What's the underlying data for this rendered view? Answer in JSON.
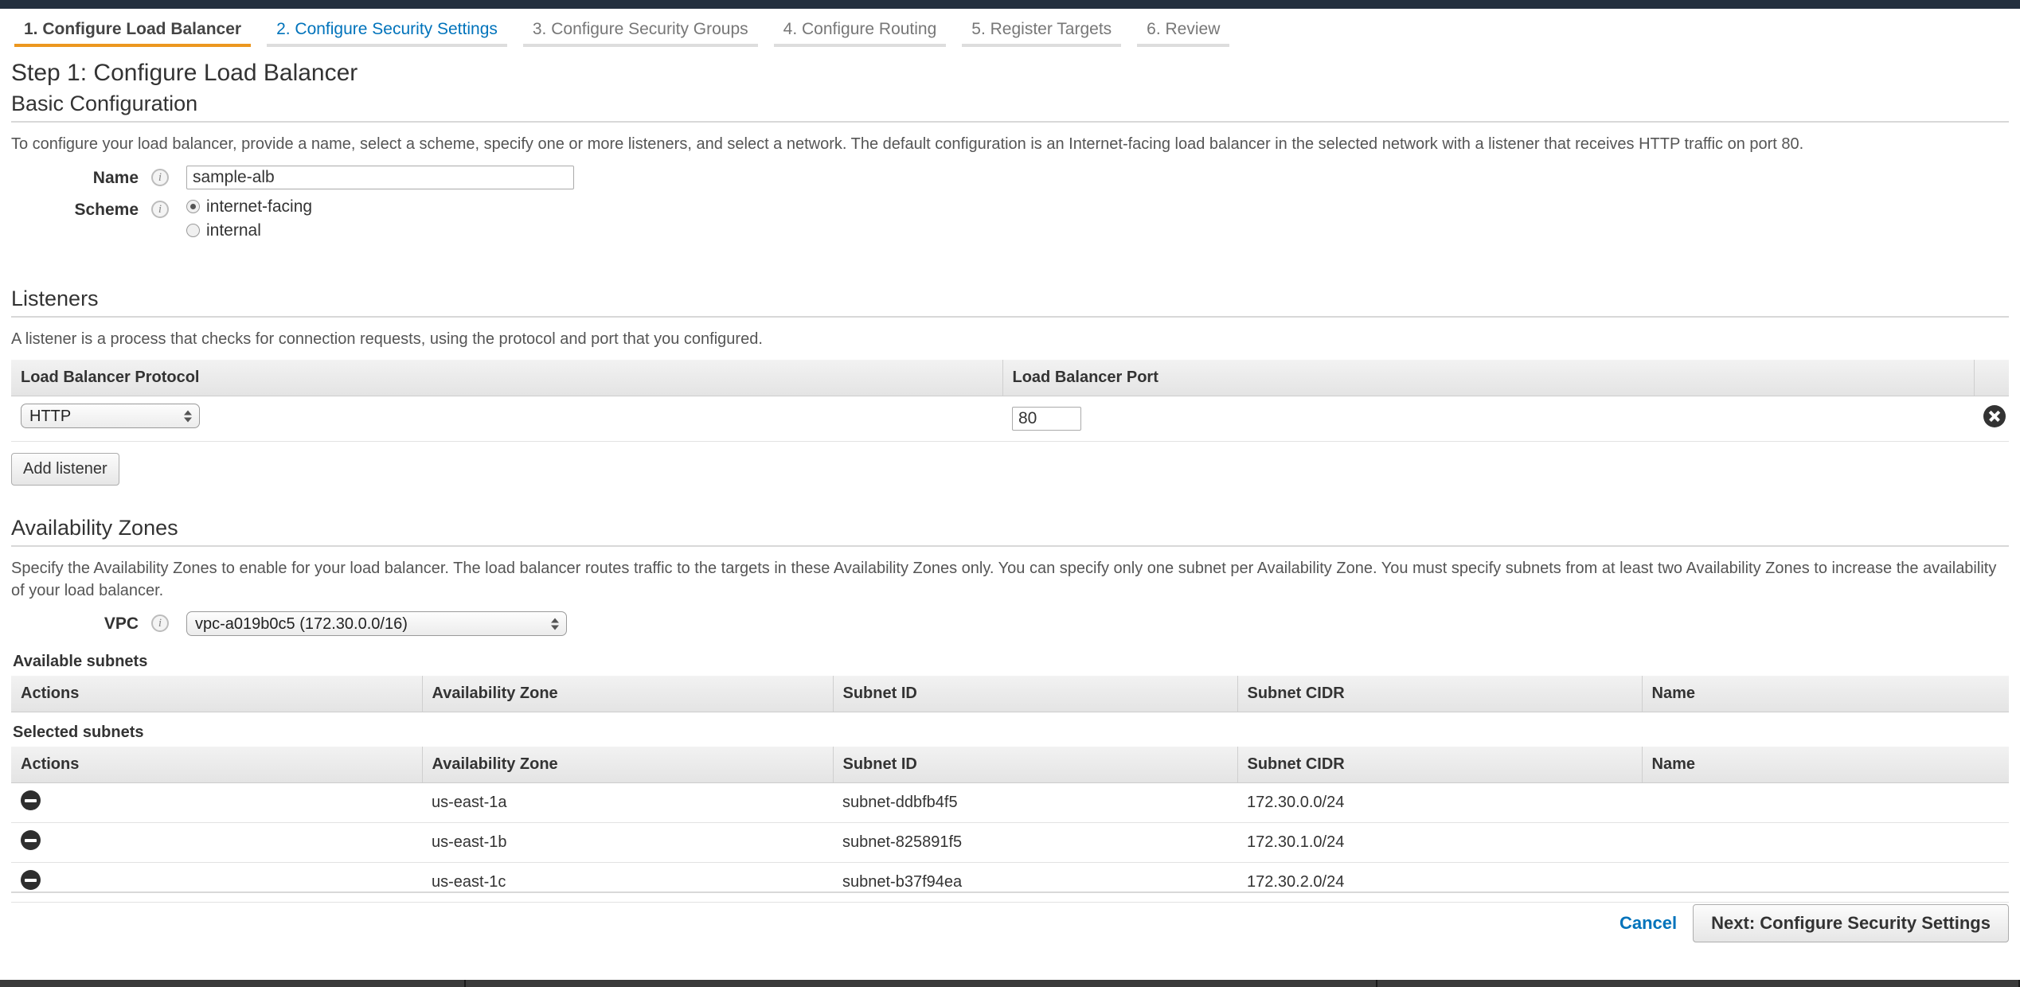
{
  "wizard": {
    "tabs": [
      {
        "label": "1. Configure Load Balancer",
        "state": "active"
      },
      {
        "label": "2. Configure Security Settings",
        "state": "link"
      },
      {
        "label": "3. Configure Security Groups",
        "state": "inactive"
      },
      {
        "label": "4. Configure Routing",
        "state": "inactive"
      },
      {
        "label": "5. Register Targets",
        "state": "inactive"
      },
      {
        "label": "6. Review",
        "state": "inactive"
      }
    ],
    "accent_color": "#ec971f",
    "link_color": "#0073bb"
  },
  "page": {
    "step_title": "Step 1: Configure Load Balancer"
  },
  "basic_configuration": {
    "heading": "Basic Configuration",
    "help": "To configure your load balancer, provide a name, select a scheme, specify one or more listeners, and select a network. The default configuration is an Internet-facing load balancer in the selected network with a listener that receives HTTP traffic on port 80.",
    "name_label": "Name",
    "name_value": "sample-alb",
    "name_placeholder": "",
    "scheme_label": "Scheme",
    "scheme_options": [
      {
        "label": "internet-facing",
        "selected": true
      },
      {
        "label": "internal",
        "selected": false
      }
    ],
    "info_icon": "info-icon"
  },
  "listeners": {
    "heading": "Listeners",
    "help": "A listener is a process that checks for connection requests, using the protocol and port that you configured.",
    "columns": [
      "Load Balancer Protocol",
      "Load Balancer Port",
      ""
    ],
    "rows": [
      {
        "protocol": "HTTP",
        "port": "80",
        "delete_icon": "delete-circle-x-icon"
      }
    ],
    "add_listener_label": "Add listener"
  },
  "availability_zones": {
    "heading": "Availability Zones",
    "help": "Specify the Availability Zones to enable for your load balancer. The load balancer routes traffic to the targets in these Availability Zones only. You can specify only one subnet per Availability Zone. You must specify subnets from at least two Availability Zones to increase the availability of your load balancer.",
    "vpc_label": "VPC",
    "vpc_value": "vpc-a019b0c5 (172.30.0.0/16)",
    "available_subnets_label": "Available subnets",
    "selected_subnets_label": "Selected subnets",
    "columns": [
      "Actions",
      "Availability Zone",
      "Subnet ID",
      "Subnet CIDR",
      "Name"
    ],
    "available_subnets": [],
    "selected_subnets": [
      {
        "action_icon": "remove-minus-circle-icon",
        "az": "us-east-1a",
        "subnet_id": "subnet-ddbfb4f5",
        "cidr": "172.30.0.0/24",
        "name": ""
      },
      {
        "action_icon": "remove-minus-circle-icon",
        "az": "us-east-1b",
        "subnet_id": "subnet-825891f5",
        "cidr": "172.30.1.0/24",
        "name": ""
      },
      {
        "action_icon": "remove-minus-circle-icon",
        "az": "us-east-1c",
        "subnet_id": "subnet-b37f94ea",
        "cidr": "172.30.2.0/24",
        "name": ""
      }
    ]
  },
  "footer": {
    "cancel_label": "Cancel",
    "next_label": "Next: Configure Security Settings"
  }
}
